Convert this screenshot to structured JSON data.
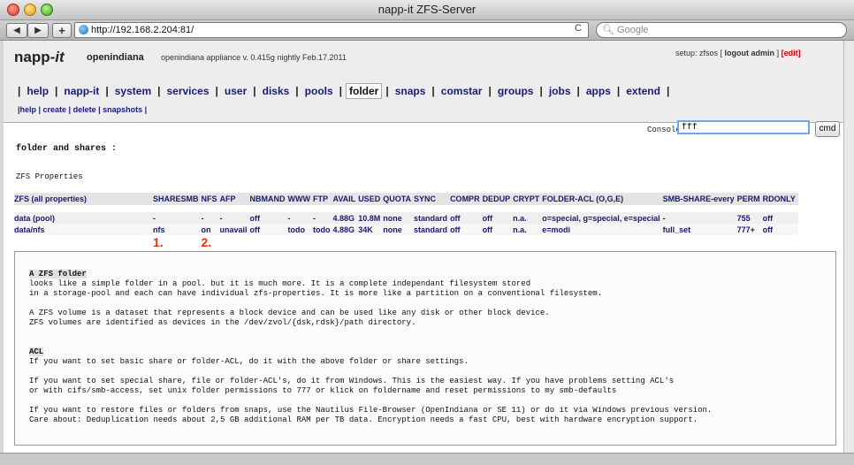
{
  "window": {
    "title": "napp-it ZFS-Server"
  },
  "toolbar": {
    "back": "◀",
    "forward": "▶",
    "add": "+",
    "url": "http://192.168.2.204:81/",
    "reload": "C",
    "search_placeholder": "Google"
  },
  "header": {
    "logo_main": "napp-",
    "logo_italic": "it",
    "brand": "openindiana",
    "appliance": "openindiana appliance v. 0.415g nightly Feb.17.2011",
    "setup": "setup: zfsos [",
    "logout": "logout admin",
    "close_bracket": "]",
    "edit": "[edit]"
  },
  "nav": {
    "items": [
      "help",
      "napp-it",
      "system",
      "services",
      "user",
      "disks",
      "pools",
      "folder",
      "snaps",
      "comstar",
      "groups",
      "jobs",
      "apps",
      "extend"
    ],
    "active": "folder"
  },
  "subnav": {
    "text": "|help | create | delete | snapshots |"
  },
  "console": {
    "label": "Console:",
    "value": "fff",
    "button": "cmd"
  },
  "section_title": "folder and shares :",
  "zfs_properties": "ZFS Properties",
  "table": {
    "headers": [
      "ZFS (all properties)",
      "SHARESMB",
      "NFS",
      "AFP",
      "NBMAND",
      "WWW",
      "FTP",
      "AVAIL",
      "USED",
      "QUOTA",
      "SYNC",
      "COMPR",
      "DEDUP",
      "CRYPT",
      "FOLDER-ACL (O,G,E)",
      "SMB-SHARE-every",
      "PERM",
      "RDONLY"
    ],
    "rows": [
      [
        "data (pool)",
        "-",
        "-",
        "-",
        "off",
        "-",
        "-",
        "4.88G",
        "10.8M",
        "none",
        "standard",
        "off",
        "off",
        "n.a.",
        "o=special, g=special, e=special",
        "-",
        "755",
        "off"
      ],
      [
        "data/nfs",
        "nfs",
        "on",
        "unavail",
        "off",
        "todo",
        "todo",
        "4.88G",
        "34K",
        "none",
        "standard",
        "off",
        "off",
        "n.a.",
        "e=modi",
        "full_set",
        "777+",
        "off"
      ]
    ],
    "marks": [
      "1.",
      "2."
    ]
  },
  "info": {
    "zfs_folder_title": "A ZFS folder",
    "zfs_folder_lines": [
      "looks like a simple folder in a pool. but it is much more. It is a complete independant filesystem stored",
      "in a storage-pool and each can have individual zfs-properties. It is more like a partition on a conventional filesystem."
    ],
    "volume_lines": [
      "A ZFS volume is a dataset that represents a block device and can be used like any disk or other block device.",
      "ZFS volumes are identified as devices in the /dev/zvol/{dsk,rdsk}/path directory."
    ],
    "acl_title": "ACL",
    "acl_line": "If you want to set basic share or folder-ACL, do it with the above folder or share settings.",
    "special_lines": [
      "If you want to set special share, file or folder-ACL's, do it from Windows. This is the easiest way. If you have problems setting ACL's",
      "or with cifs/smb-access, set unix folder permissions to 777 or klick on foldername and reset permissions to my smb-defaults"
    ],
    "restore_lines": [
      "If you want to restore files or folders from snaps, use the Nautilus File-Browser (OpenIndiana or SE 11) or do it via Windows previous version.",
      "Care about: Deduplication needs about 2,5 GB additional RAM per TB data. Encryption needs a fast CPU, best with hardware encryption support."
    ]
  }
}
